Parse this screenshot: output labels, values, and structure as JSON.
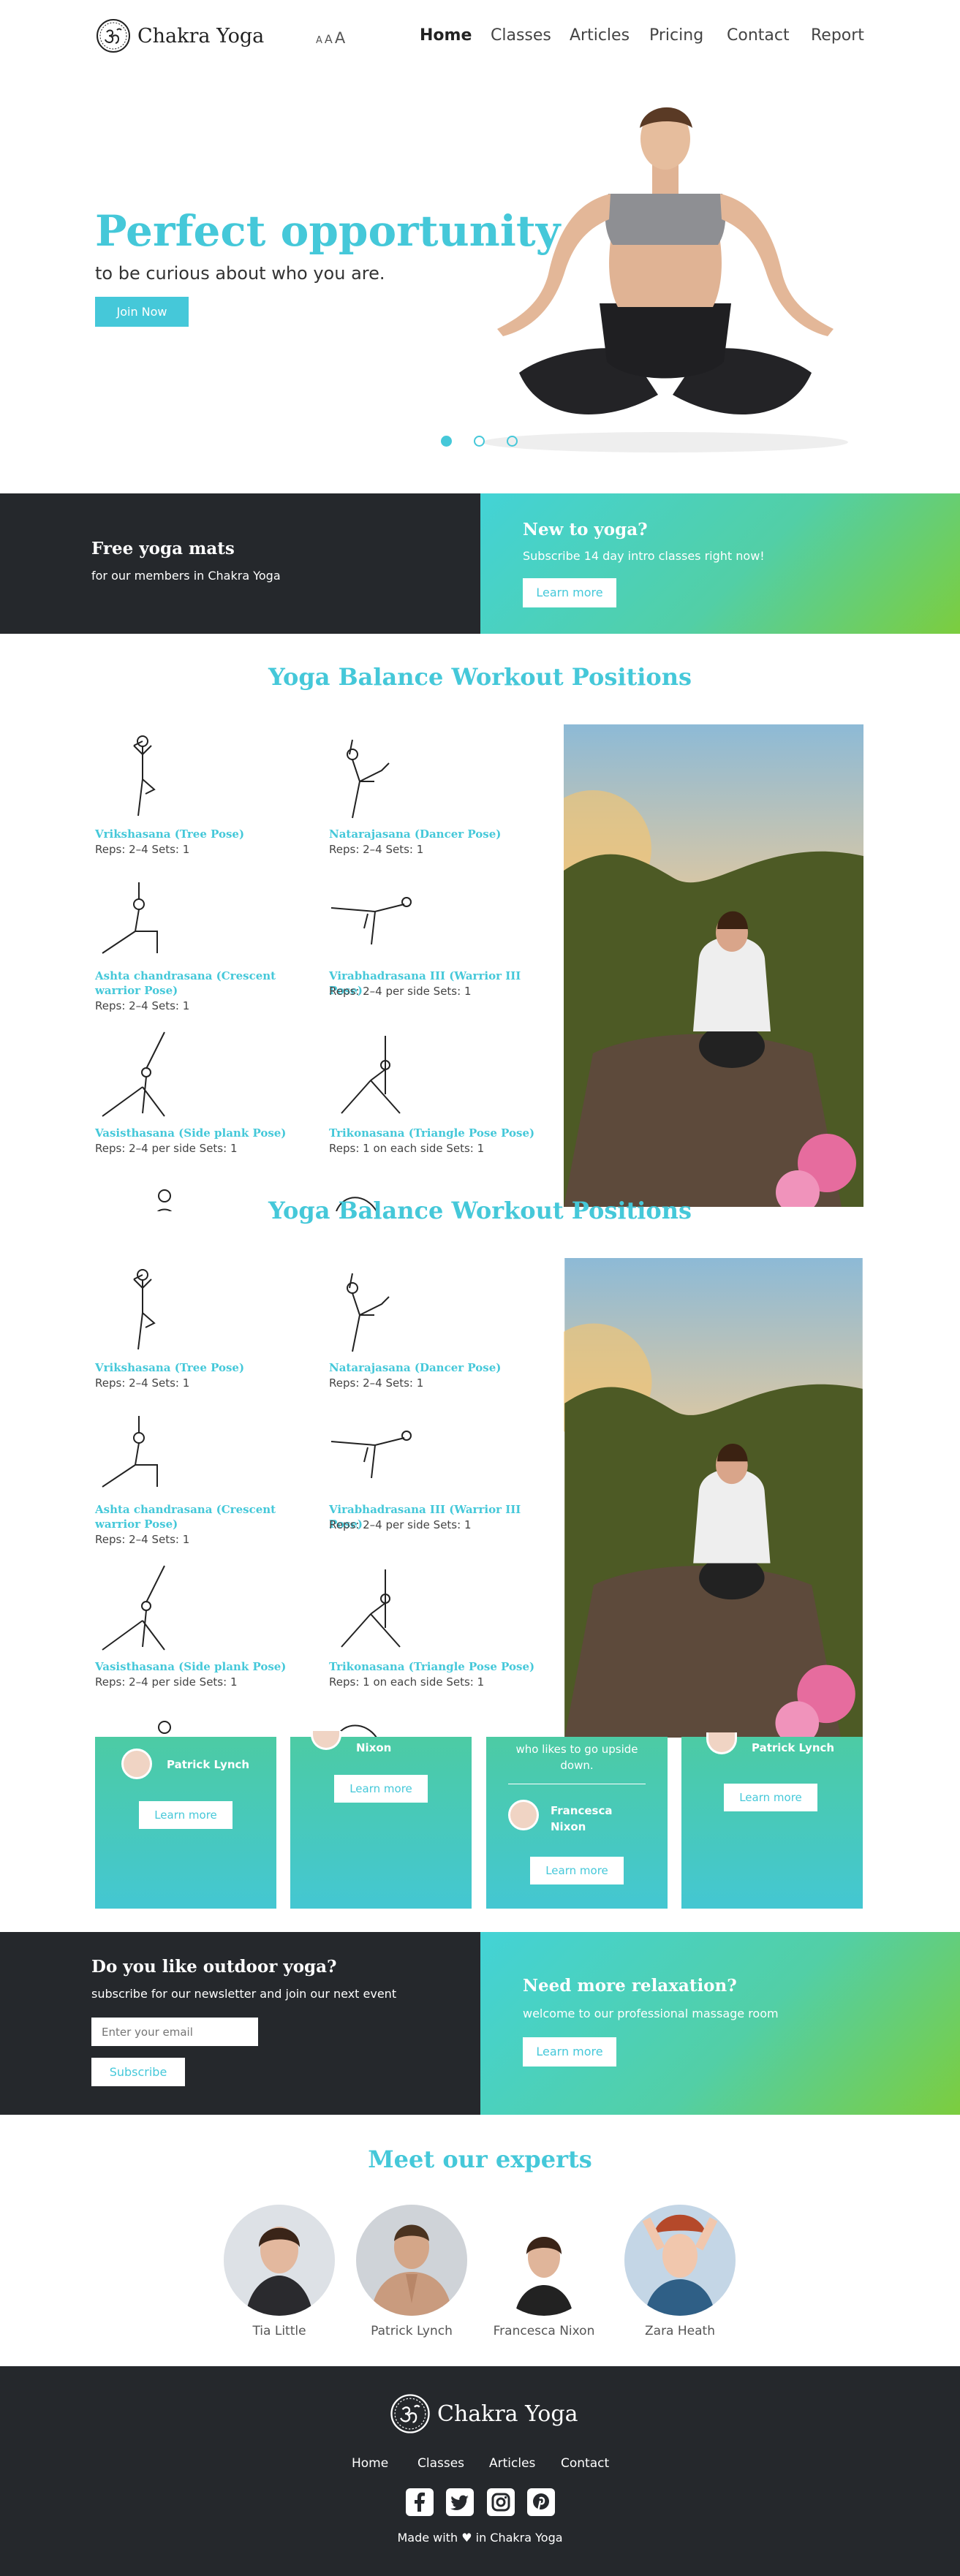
{
  "nav": {
    "logo_text": "Chakra Yoga",
    "font_sizes": [
      "A",
      "A",
      "A"
    ],
    "items": [
      "Home",
      "Classes",
      "Articles",
      "Pricing",
      "Contact",
      "Report"
    ]
  },
  "hero": {
    "title": "Perfect opportunity",
    "subtitle": "to be curious about who you are.",
    "button": "Join Now",
    "slides": 3,
    "active_slide": 1
  },
  "promo": {
    "left_title": "Free yoga mats",
    "left_text": "for our members in Chakra Yoga",
    "right_title": "New to yoga?",
    "right_text": "Subscribe 14 day intro classes right now!",
    "right_button": "Learn more"
  },
  "positions": {
    "title": "Yoga Balance Workout Positions",
    "poses": [
      {
        "name": "Vrikshasana (Tree Pose)",
        "reps": "Reps: 2–4 Sets: 1"
      },
      {
        "name": "Natarajasana (Dancer Pose)",
        "reps": "Reps: 2–4 Sets: 1"
      },
      {
        "name": "Ashta chandrasana (Crescent warrior Pose)",
        "reps": "Reps: 2–4 Sets: 1"
      },
      {
        "name": "Virabhadrasana III (Warrior III Pose)",
        "reps": "Reps: 2–4 per side Sets: 1"
      },
      {
        "name": "Vasisthasana (Side plank Pose)",
        "reps": "Reps: 2–4 per side Sets: 1"
      },
      {
        "name": "Trikonasana (Triangle Pose Pose)",
        "reps": "Reps: 1 on each side Sets: 1"
      }
    ]
  },
  "testimonials": {
    "cards": [
      {
        "name": "Patrick Lynch",
        "quote": "",
        "button": "Learn more"
      },
      {
        "name": "Nixon",
        "quote": "",
        "button": "Learn more"
      },
      {
        "name": "Francesca Nixon",
        "quote": "who likes to go upside down.",
        "button": "Learn more"
      },
      {
        "name": "Patrick Lynch",
        "quote": "",
        "button": "Learn more"
      }
    ]
  },
  "newsletter": {
    "left_title": "Do you like outdoor yoga?",
    "left_text": "subscribe for our newsletter and join our next event",
    "email_placeholder": "Enter your email",
    "subscribe_button": "Subscribe",
    "right_title": "Need more relaxation?",
    "right_text": "welcome to our professional massage room",
    "right_button": "Learn more"
  },
  "experts": {
    "title": "Meet our experts",
    "people": [
      "Tia Little",
      "Patrick Lynch",
      "Francesca Nixon",
      "Zara Heath"
    ]
  },
  "footer": {
    "logo_text": "Chakra Yoga",
    "links": [
      "Home",
      "Classes",
      "Articles",
      "Contact"
    ],
    "social_icons": [
      "facebook-icon",
      "twitter-icon",
      "instagram-icon",
      "pinterest-icon"
    ],
    "made_with_prefix": "Made with",
    "made_with_suffix": "in Chakra Yoga"
  },
  "colors": {
    "accent": "#45c8d9",
    "dark": "#25282c",
    "gradient_start": "#43d3d6",
    "gradient_end": "#7ccd3e"
  }
}
